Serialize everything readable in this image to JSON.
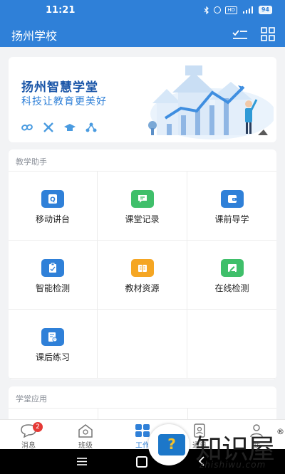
{
  "status_bar": {
    "time": "11:21",
    "battery": "94",
    "hd": "HD"
  },
  "app_bar": {
    "title": "扬州学校",
    "icons": [
      "checklist-icon",
      "grid-icon"
    ]
  },
  "banner": {
    "title": "扬州智慧学堂",
    "subtitle": "科技让教育更美好",
    "icons": [
      "chain-icon",
      "tools-icon",
      "graduation-cap-icon",
      "network-icon"
    ]
  },
  "teaching": {
    "title": "教学助手",
    "items": [
      {
        "label": "移动讲台",
        "icon": "mobile-podium-icon",
        "color": "#2f80d8"
      },
      {
        "label": "课堂记录",
        "icon": "chat-record-icon",
        "color": "#3fbf6a"
      },
      {
        "label": "课前导学",
        "icon": "wallet-guide-icon",
        "color": "#2f80d8"
      },
      {
        "label": "智能检测",
        "icon": "clipboard-check-icon",
        "color": "#2f80d8"
      },
      {
        "label": "教材资源",
        "icon": "book-resource-icon",
        "color": "#f5a623"
      },
      {
        "label": "在线检测",
        "icon": "online-test-icon",
        "color": "#3fbf6a"
      },
      {
        "label": "课后练习",
        "icon": "homework-icon",
        "color": "#2f80d8"
      }
    ]
  },
  "apps": {
    "title": "学堂应用"
  },
  "tabs": [
    {
      "label": "消息",
      "icon": "message-icon",
      "badge": "2"
    },
    {
      "label": "班级",
      "icon": "class-house-icon"
    },
    {
      "label": "工作",
      "icon": "work-grid-icon"
    },
    {
      "label": "通讯",
      "icon": "contacts-icon"
    },
    {
      "label": "我",
      "icon": "profile-icon"
    }
  ],
  "watermark": {
    "text": "知识屋",
    "url": "zhishiwu.com",
    "reg": "®",
    "symbol": "?"
  }
}
